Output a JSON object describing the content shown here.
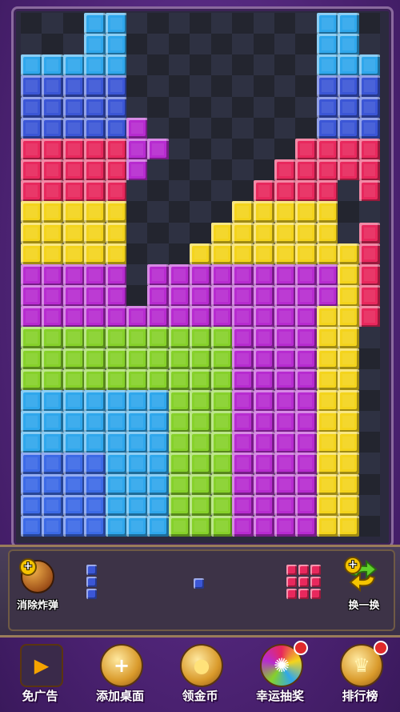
{
  "board": {
    "cols": 17,
    "rows": 25,
    "palette": {
      "C": "#2fa7ec",
      "B": "#3b56d6",
      "R": "#e8285d",
      "Y": "#f4d41c",
      "P": "#b72bd0",
      "G": "#86d12a",
      "H": "#3c6ae6"
    },
    "grid": [
      "...CC.........CC.",
      "...CC.........CC.",
      "CCCCC.........CCC",
      "BBBBB.........BBB",
      "BBBBB.........BBB",
      "BBBBBP........BBB",
      "RRRRRPP......RRRR",
      "RRRRRP......RRRRR",
      "RRRRR......RRRR.R",
      "YYYYY.....YYYYY..",
      "YYYYY....YYYYYY.R",
      "YYYYY...YYYYYYYYR",
      "PPPPP.PPPPPPPPPYR",
      "PPPPP.PPPPPPPPPYR",
      "PPPPPPPPPPPPPPYYR",
      "GGGGGGGGGGPPPPYY.",
      "GGGGGGGGGGPPPPYY.",
      "GGGGGGGGGGPPPPYY.",
      "CCCCCCCGGGPPPPYY.",
      "CCCCCCCGGGPPPPYY.",
      "CCCCCCCGGGPPPPYY.",
      "HHHHCCCGGGPPPPYY.",
      "HHHHCCCGGGPPPPYY.",
      "HHHHCCCGGGPPPPYY.",
      "HHHHCCCGGGPPPPYY."
    ]
  },
  "tools": {
    "bomb_label": "消除炸弹",
    "swap_label": "换一换",
    "bomb_icon": "bomb-icon",
    "swap_icon": "swap-arrows-icon"
  },
  "pieces": [
    {
      "color": "#3b56d6",
      "shape": [
        "X",
        "X",
        "X"
      ]
    },
    {
      "color": "#3b56d6",
      "shape": [
        "X"
      ]
    },
    {
      "color": "#e8285d",
      "shape": [
        "XXX",
        "XXX",
        "XXX"
      ]
    }
  ],
  "nav": [
    {
      "label": "免广告",
      "icon": "no-ads-tv-icon",
      "glyph": "▶"
    },
    {
      "label": "添加桌面",
      "icon": "add-desktop-icon",
      "glyph": "+"
    },
    {
      "label": "领金币",
      "icon": "gold-coin-icon",
      "glyph": "●"
    },
    {
      "label": "幸运抽奖",
      "icon": "lucky-wheel-icon",
      "glyph": "✺"
    },
    {
      "label": "排行榜",
      "icon": "trophy-icon",
      "glyph": "♛"
    }
  ]
}
